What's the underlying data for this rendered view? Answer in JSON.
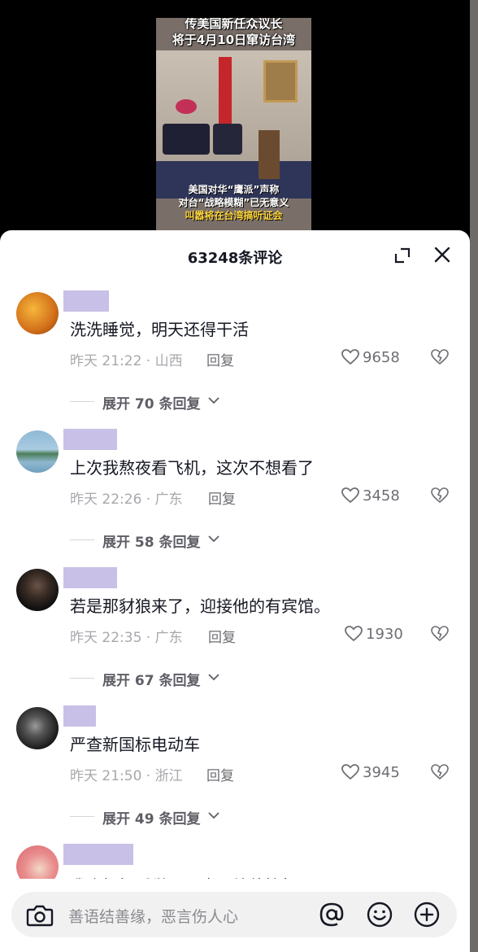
{
  "video": {
    "title_line1": "传美国新任众议长",
    "title_line2": "将于4月10日窜访台湾",
    "caption_line1": "美国对华“鹰派”声称",
    "caption_line2": "对台“战略模糊”已无意义",
    "caption_line3": "叫嚣将在台湾搞听证会"
  },
  "sheet": {
    "title": "63248条评论",
    "expand_icon": "fullscreen-icon",
    "close_icon": "close-icon"
  },
  "comments": [
    {
      "text": "洗洗睡觉，明天还得干活",
      "time": "昨天 21:22 · 山西",
      "reply": "回复",
      "likes": "9658",
      "expand": "展开 70 条回复"
    },
    {
      "text": "上次我熬夜看飞机，这次不想看了",
      "time": "昨天 22:26 · 广东",
      "reply": "回复",
      "likes": "3458",
      "expand": "展开 58 条回复"
    },
    {
      "text": "若是那豺狼来了，迎接他的有宾馆。",
      "time": "昨天 22:35 · 广东",
      "reply": "回复",
      "likes": "1930",
      "expand": "展开 67 条回复"
    },
    {
      "text": "严查新国标电动车",
      "time": "昨天 21:50 · 浙江",
      "reply": "回复",
      "likes": "3945",
      "expand": "展开 49 条回复"
    },
    {
      "text": "我会好好睡觉，再也不给他接机了"
    }
  ],
  "input": {
    "placeholder": "善语结善缘，恶言伤人心",
    "icons": [
      "camera-icon",
      "at-icon",
      "emoji-icon",
      "plus-icon"
    ]
  },
  "colors": {
    "username_block": "#c8c0e6",
    "meta_text": "#a8a8ad",
    "text": "#161823"
  }
}
